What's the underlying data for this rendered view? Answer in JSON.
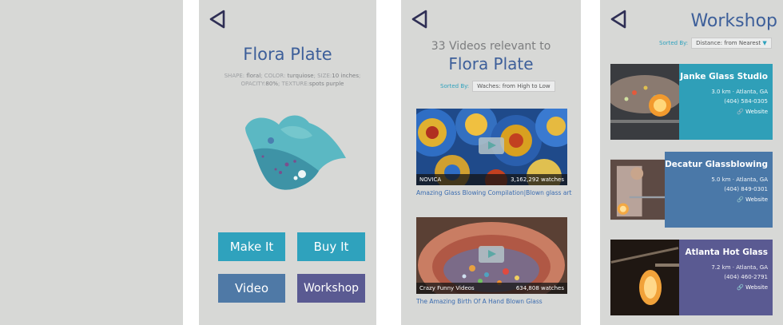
{
  "product": {
    "title": "Flora Plate",
    "attributes": [
      {
        "key": "SHAPE:",
        "value": "floral"
      },
      {
        "key": "COLOR:",
        "value": "turquiose"
      },
      {
        "key": "SIZE:",
        "value": "10 inches"
      },
      {
        "key": "OPACITY:",
        "value": "80%"
      },
      {
        "key": "TEXTURE:",
        "value": "spots purple"
      }
    ],
    "buttons": {
      "make": "Make It",
      "buy": "Buy It",
      "video": "Video",
      "workshop": "Workshop"
    }
  },
  "videos": {
    "heading": "33 Videos relevant to",
    "subject": "Flora Plate",
    "sort_label": "Sorted By:",
    "sort_value": "Waches: from High to Low",
    "items": [
      {
        "channel": "NOVICA",
        "watches": "3,162,292 watches",
        "title": "Amazing Glass Blowing Compilation|Blown glass art"
      },
      {
        "channel": "Crazy Funny Videos",
        "watches": "634,808 watches",
        "title": "The Amazing Birth Of A Hand Blown Glass"
      }
    ]
  },
  "workshop": {
    "title": "Workshop",
    "sort_label": "Sorted By:",
    "sort_value": "Distance: from Nearest",
    "shops": [
      {
        "name": "Janke Glass Studio",
        "distance": "3.0 km · Atlanta, GA",
        "phone": "(404) 584-0305",
        "link": "Website",
        "color": "#2f9fb8"
      },
      {
        "name": "Decatur Glassblowing",
        "distance": "5.0 km · Atlanta, GA",
        "phone": "(404) 849-0301",
        "link": "Website",
        "color": "#4a78a8"
      },
      {
        "name": "Atlanta Hot Glass",
        "distance": "7.2 km · Atlanta, GA",
        "phone": "(404) 460-2791",
        "link": "Website",
        "color": "#5a5a92"
      }
    ]
  },
  "colors": {
    "panel_bg": "#d7d8d6",
    "title_blue": "#3d5f9a",
    "teal": "#2fa2bd",
    "blue": "#4f79a6",
    "purple": "#5a5a92"
  }
}
